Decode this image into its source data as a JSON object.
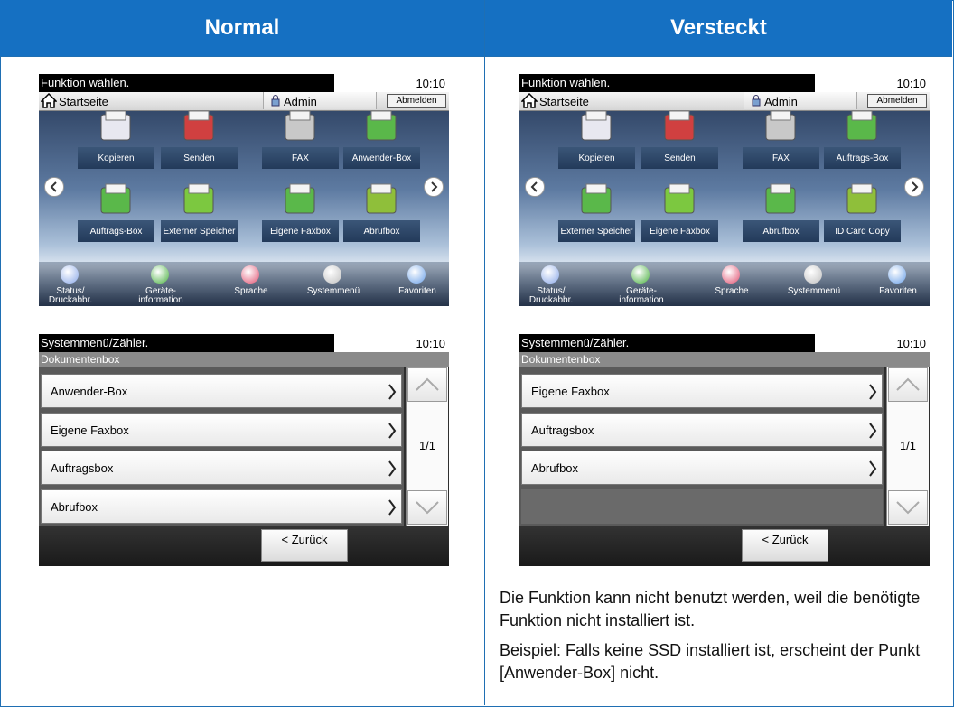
{
  "headers": {
    "normal": "Normal",
    "hidden": "Versteckt"
  },
  "home_normal": {
    "message": "Funktion wählen.",
    "time": "10:10",
    "home_label": "Startseite",
    "admin_label": "Admin",
    "logout_label": "Abmelden",
    "tiles": [
      "Kopieren",
      "Senden",
      "FAX",
      "Anwender-Box",
      "Auftrags-Box",
      "Externer Speicher",
      "Eigene Faxbox",
      "Abrufbox"
    ],
    "bottom": [
      "Status/\nDruckabbr.",
      "Geräte-\ninformation",
      "Sprache",
      "Systemmenü",
      "Favoriten"
    ]
  },
  "home_hidden": {
    "message": "Funktion wählen.",
    "time": "10:10",
    "home_label": "Startseite",
    "admin_label": "Admin",
    "logout_label": "Abmelden",
    "tiles": [
      "Kopieren",
      "Senden",
      "FAX",
      "Auftrags-Box",
      "Externer Speicher",
      "Eigene Faxbox",
      "Abrufbox",
      "ID Card Copy"
    ],
    "bottom": [
      "Status/\nDruckabbr.",
      "Geräte-\ninformation",
      "Sprache",
      "Systemmenü",
      "Favoriten"
    ]
  },
  "sys_normal": {
    "message": "Systemmenü/Zähler.",
    "time": "10:10",
    "subtitle": "Dokumentenbox",
    "rows": [
      "Anwender-Box",
      "Eigene Faxbox",
      "Auftragsbox",
      "Abrufbox"
    ],
    "page": "1/1",
    "back": "< Zurück"
  },
  "sys_hidden": {
    "message": "Systemmenü/Zähler.",
    "time": "10:10",
    "subtitle": "Dokumentenbox",
    "rows": [
      "Eigene Faxbox",
      "Auftragsbox",
      "Abrufbox"
    ],
    "page": "1/1",
    "back": "< Zurück"
  },
  "notes": {
    "p1": "Die Funktion kann nicht benutzt werden, weil die benötigte Funktion nicht installiert ist.",
    "p2": "Beispiel: Falls keine SSD installiert ist, erscheint der Punkt [Anwender-Box] nicht."
  },
  "colors": {
    "header": "#1570c2",
    "border": "#1f6fb3"
  }
}
